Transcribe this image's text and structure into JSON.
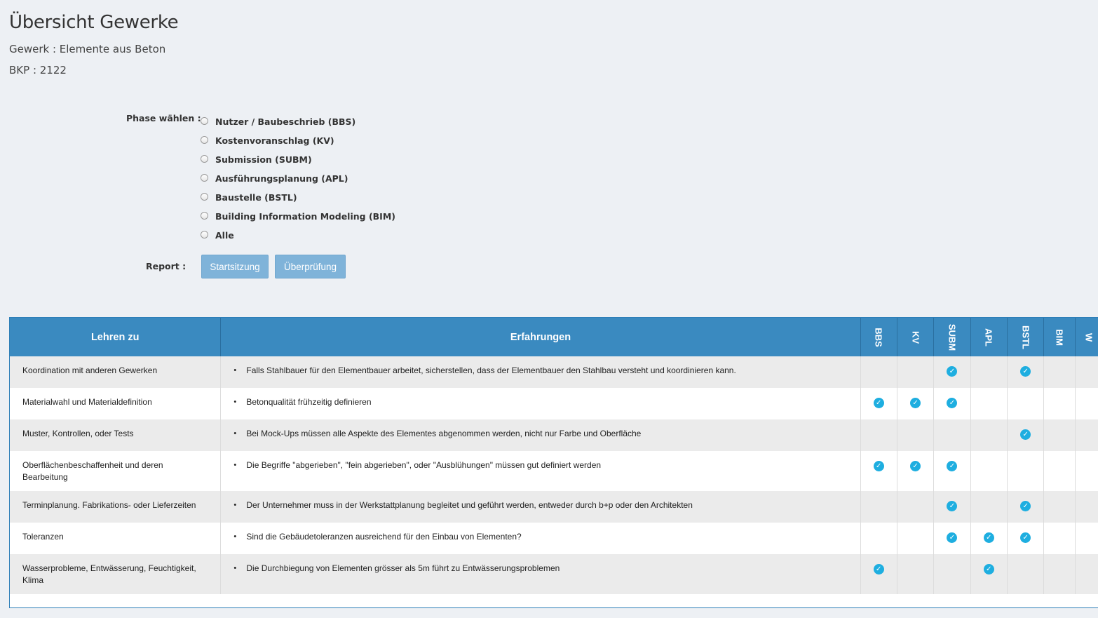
{
  "page": {
    "title": "Übersicht Gewerke",
    "gewerk": "Gewerk : Elemente aus Beton",
    "bkp": "BKP : 2122"
  },
  "phase": {
    "label": "Phase wählen :",
    "options": [
      "Nutzer / Baubeschrieb (BBS)",
      "Kostenvoranschlag (KV)",
      "Submission (SUBM)",
      "Ausführungsplanung (APL)",
      "Baustelle (BSTL)",
      "Building Information Modeling (BIM)",
      "Alle"
    ]
  },
  "report": {
    "label": "Report :",
    "start_button": "Startsitzung",
    "review_button": "Überprüfung"
  },
  "table": {
    "headers": {
      "topic": "Lehren zu",
      "experience": "Erfahrungen",
      "phases": [
        "BBS",
        "KV",
        "SUBM",
        "APL",
        "BSTL",
        "BIM",
        "W"
      ]
    },
    "rows": [
      {
        "topic": "Koordination mit anderen Gewerken",
        "experience": "Falls Stahlbauer für den Elementbauer arbeitet, sicherstellen, dass der Elementbauer den Stahlbau versteht und koordinieren kann.",
        "checks": [
          false,
          false,
          true,
          false,
          true,
          false,
          false
        ]
      },
      {
        "topic": "Materialwahl und Materialdefinition",
        "experience": "Betonqualität frühzeitig definieren",
        "checks": [
          true,
          true,
          true,
          false,
          false,
          false,
          false
        ]
      },
      {
        "topic": "Muster, Kontrollen, oder Tests",
        "experience": "Bei Mock-Ups müssen alle Aspekte des Elementes abgenommen werden, nicht nur Farbe und Oberfläche",
        "checks": [
          false,
          false,
          false,
          false,
          true,
          false,
          false
        ]
      },
      {
        "topic": "Oberflächenbeschaffenheit und deren Bearbeitung",
        "experience": "Die Begriffe \"abgerieben\", \"fein abgerieben\", oder \"Ausblühungen\" müssen gut definiert werden",
        "checks": [
          true,
          true,
          true,
          false,
          false,
          false,
          false
        ]
      },
      {
        "topic": "Terminplanung. Fabrikations- oder Lieferzeiten",
        "experience": "Der Unternehmer muss in der Werkstattplanung begleitet und geführt werden, entweder durch b+p oder den Architekten",
        "checks": [
          false,
          false,
          true,
          false,
          true,
          false,
          false
        ]
      },
      {
        "topic": "Toleranzen",
        "experience": "Sind die Gebäudetoleranzen ausreichend für den Einbau von Elementen?",
        "checks": [
          false,
          false,
          true,
          true,
          true,
          false,
          false
        ]
      },
      {
        "topic": "Wasserprobleme, Entwässerung, Feuchtigkeit, Klima",
        "experience": "Die Durchbiegung von Elementen grösser als 5m führt zu Entwässerungsproblemen",
        "checks": [
          true,
          false,
          false,
          true,
          false,
          false,
          false
        ]
      }
    ]
  },
  "colors": {
    "header_bg": "#3a8ac0",
    "check": "#1eaee0",
    "button": "#7fb3d9",
    "page_bg": "#edf0f4"
  },
  "icons": {
    "check": "check-circle-icon"
  }
}
